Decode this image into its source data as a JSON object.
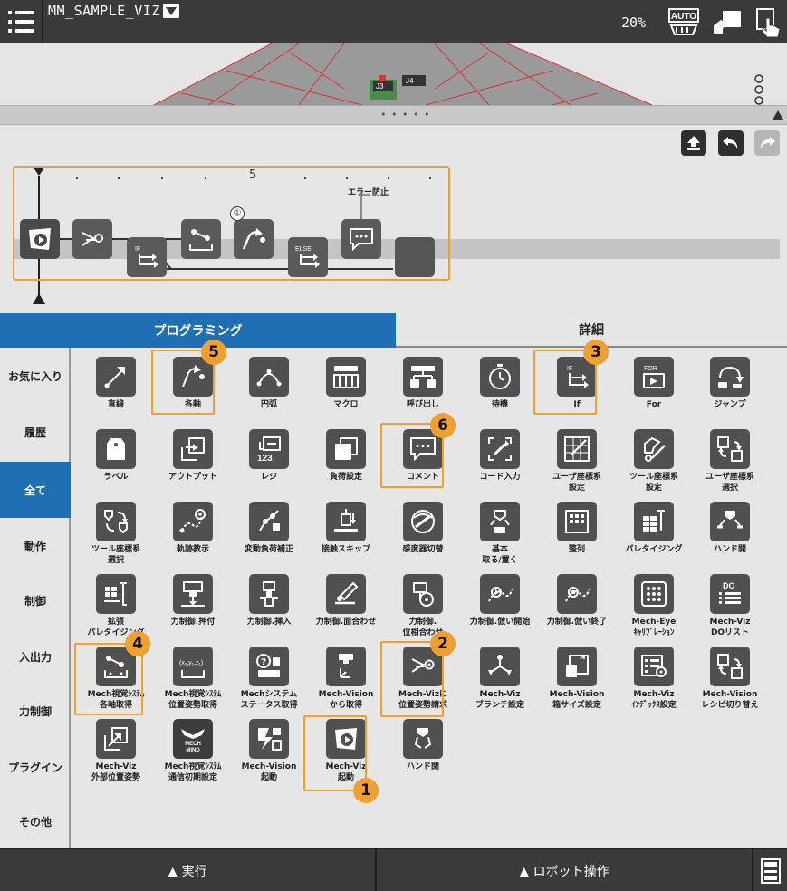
{
  "topbar": {
    "program_name": "MM_SAMPLE_VIZ",
    "speed": "20%",
    "auto_label": "AUTO"
  },
  "toolbar": {
    "ruler_mark": "5",
    "circled_one": "①",
    "error_prevention_label": "エラー防止",
    "if_label": "IF",
    "else_label": "ELSE"
  },
  "tabs": {
    "programming": "プログラミング",
    "detail": "詳細"
  },
  "categories": [
    "お気に入り",
    "履歴",
    "全て",
    "動作",
    "制御",
    "入出力",
    "力制御",
    "プラグイン",
    "その他"
  ],
  "active_category": "全て",
  "palette": [
    {
      "label": "直線",
      "icon": "line-move-icon"
    },
    {
      "label": "各軸",
      "icon": "joint-move-icon"
    },
    {
      "label": "円弧",
      "icon": "arc-icon"
    },
    {
      "label": "マクロ",
      "icon": "macro-icon"
    },
    {
      "label": "呼び出し",
      "icon": "call-icon"
    },
    {
      "label": "待機",
      "icon": "wait-icon"
    },
    {
      "label": "If",
      "icon": "if-icon"
    },
    {
      "label": "For",
      "icon": "for-icon"
    },
    {
      "label": "ジャンプ",
      "icon": "jump-icon"
    },
    {
      "label": "ラベル",
      "icon": "label-tag-icon"
    },
    {
      "label": "アウトプット",
      "icon": "output-icon"
    },
    {
      "label": "レジ",
      "icon": "register-icon"
    },
    {
      "label": "負荷設定",
      "icon": "payload-icon"
    },
    {
      "label": "コメント",
      "icon": "comment-icon"
    },
    {
      "label": "コード入力",
      "icon": "code-input-icon"
    },
    {
      "label": "ユーザ座標系\n設定",
      "icon": "user-frame-set-icon"
    },
    {
      "label": "ツール座標系\n設定",
      "icon": "tool-frame-set-icon"
    },
    {
      "label": "ユーザ座標系\n選択",
      "icon": "user-frame-select-icon"
    },
    {
      "label": "ツール座標系\n選択",
      "icon": "tool-frame-select-icon"
    },
    {
      "label": "軌跡教示",
      "icon": "path-teach-icon"
    },
    {
      "label": "変動負荷補正",
      "icon": "variable-load-icon"
    },
    {
      "label": "接触スキップ",
      "icon": "contact-skip-icon"
    },
    {
      "label": "感度器切替",
      "icon": "sensitivity-switch-icon"
    },
    {
      "label": "基本\n取る/置く",
      "icon": "pick-place-icon"
    },
    {
      "label": "整列",
      "icon": "align-icon"
    },
    {
      "label": "パレタイジング",
      "icon": "palletizing-icon"
    },
    {
      "label": "ハンド開",
      "icon": "hand-open-icon"
    },
    {
      "label": "拡張\nパレタイジング",
      "icon": "ext-palletizing-icon"
    },
    {
      "label": "力制御.押付",
      "icon": "force-press-icon"
    },
    {
      "label": "力制御.挿入",
      "icon": "force-insert-icon"
    },
    {
      "label": "力制御.面合わせ",
      "icon": "force-surface-icon"
    },
    {
      "label": "力制御.\n位相合わせ",
      "icon": "force-phase-icon"
    },
    {
      "label": "力制御.倣い開始",
      "icon": "force-follow-start-icon"
    },
    {
      "label": "力制御.倣い終了",
      "icon": "force-follow-end-icon"
    },
    {
      "label": "Mech-Eye\nｷｬﾘﾌﾞﾚｰｼｮﾝ",
      "icon": "mech-eye-calib-icon"
    },
    {
      "label": "Mech-Viz\nDOリスト",
      "icon": "do-list-icon"
    },
    {
      "label": "Mech視覚ｼｽﾃﾑ\n各軸取得",
      "icon": "get-joints-icon"
    },
    {
      "label": "Mech視覚ｼｽﾃﾑ\n位置姿勢取得",
      "icon": "get-pose-icon"
    },
    {
      "label": "Mechシステム\nステータス取得",
      "icon": "get-status-icon"
    },
    {
      "label": "Mech-Vision\nから取得",
      "icon": "vision-get-icon"
    },
    {
      "label": "Mech-Vizに\n位置姿勢請求",
      "icon": "viz-request-pose-icon"
    },
    {
      "label": "Mech-Viz\nブランチ設定",
      "icon": "branch-set-icon"
    },
    {
      "label": "Mech-Vision\n箱サイズ設定",
      "icon": "box-size-icon"
    },
    {
      "label": "Mech-Viz\nｲﾝﾃﾞｯｸｽ設定",
      "icon": "index-set-icon"
    },
    {
      "label": "Mech-Vision\nレシピ切り替え",
      "icon": "recipe-switch-icon"
    },
    {
      "label": "Mech-Viz\n外部位置姿勢",
      "icon": "external-pose-icon"
    },
    {
      "label": "Mech視覚ｼｽﾃﾑ\n通信初期設定",
      "icon": "mech-mind-comm-icon"
    },
    {
      "label": "Mech-Vision\n起動",
      "icon": "vision-start-icon"
    },
    {
      "label": "Mech-Viz\n起動",
      "icon": "viz-start-icon"
    },
    {
      "label": "ハンド閉",
      "icon": "hand-close-icon"
    }
  ],
  "badges": [
    "1",
    "2",
    "3",
    "4",
    "5",
    "6"
  ],
  "palette_extra": {
    "mech_mind_text_1": "MECH",
    "mech_mind_text_2": "MIND",
    "do_text": "DO",
    "for_text": "FOR",
    "if_text": "IF",
    "register_number": "123",
    "xyz_text": "(x₁,y₁,z₁)"
  },
  "bottombar": {
    "execute": "▲ 実行",
    "robot_operation": "▲ ロボット操作"
  },
  "colors": {
    "accent_blue": "#1f6fb5",
    "highlight_orange": "#f0a030",
    "icon_gray": "#505050",
    "bar_dark": "#3a3a3a"
  }
}
